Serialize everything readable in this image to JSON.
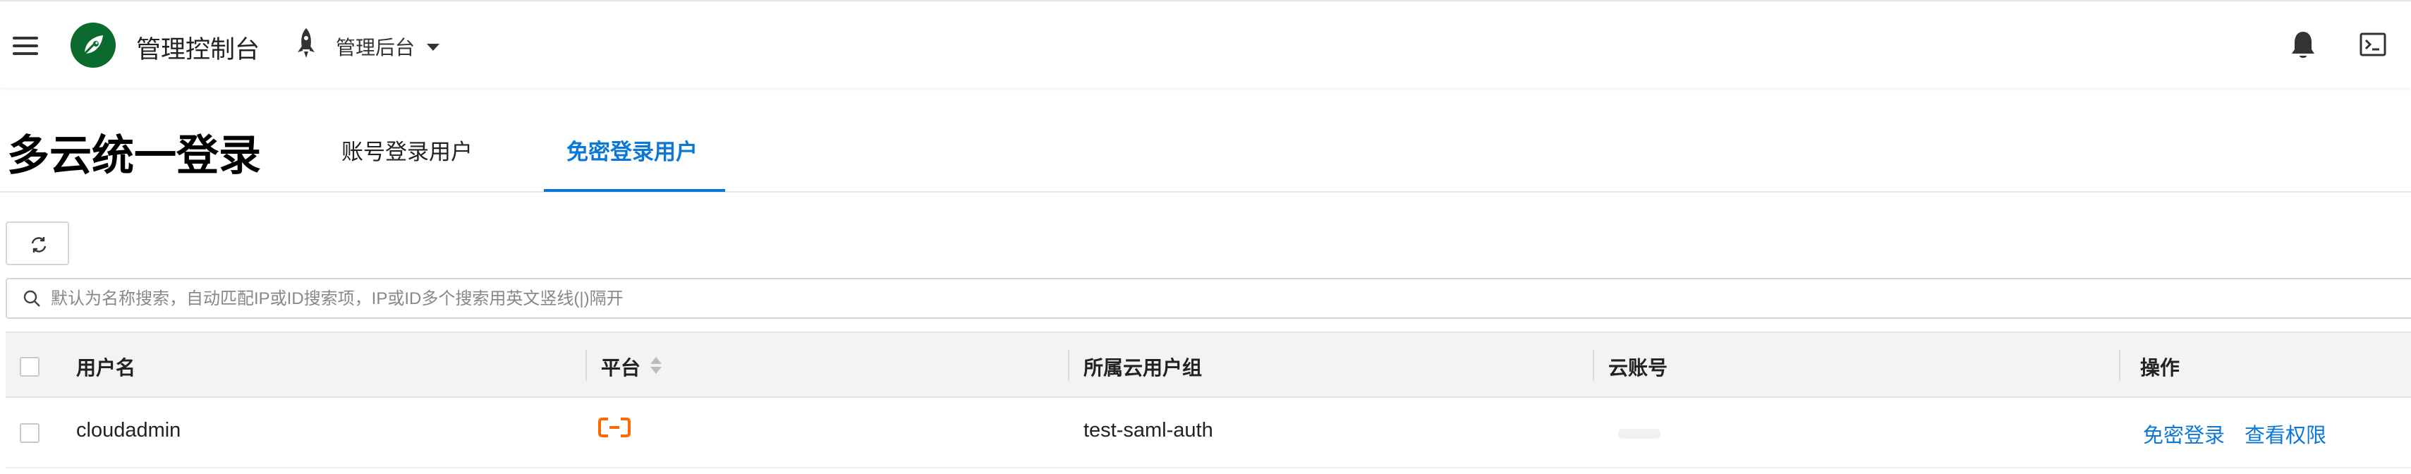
{
  "header": {
    "app_title": "管理控制台",
    "switcher_label": "管理后台",
    "icons": [
      "menu-icon",
      "logo-icon",
      "rocket-icon",
      "caret-down-icon",
      "bell-icon",
      "console-icon"
    ]
  },
  "page": {
    "title": "多云统一登录",
    "tabs": [
      {
        "label": "账号登录用户",
        "active": false
      },
      {
        "label": "免密登录用户",
        "active": true
      }
    ]
  },
  "search": {
    "placeholder": "默认为名称搜索，自动匹配IP或ID搜索项，IP或ID多个搜索用英文竖线(|)隔开",
    "value": ""
  },
  "table": {
    "columns": [
      "用户名",
      "平台",
      "所属云用户组",
      "云账号",
      "操作"
    ],
    "rows": [
      {
        "username": "cloudadmin",
        "platform_icon": "alibaba-cloud-icon",
        "user_group": "test-saml-auth",
        "cloud_account": "",
        "actions": [
          "免密登录",
          "查看权限"
        ]
      }
    ]
  },
  "colors": {
    "accent": "#0b78d8",
    "brand_green": "#0b6b2f",
    "platform_orange": "#ff6a00"
  }
}
